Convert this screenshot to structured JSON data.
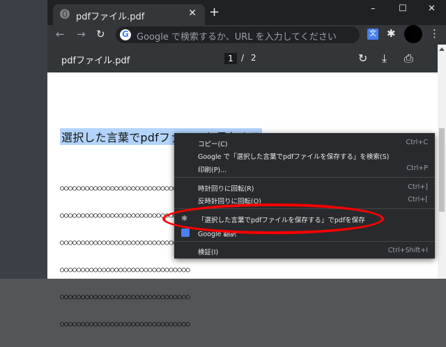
{
  "tab": {
    "title": "pdfファイル.pdf",
    "close": "✕",
    "new": "+"
  },
  "window": {
    "minimize": "–",
    "maximize": "☐",
    "close": "✕"
  },
  "toolbar": {
    "back": "←",
    "forward": "→",
    "reload": "↻",
    "omnibox_placeholder": "Google で検索するか、URL を入力してください"
  },
  "pdf": {
    "title": "pdfファイル.pdf",
    "page_current": "1",
    "page_sep": "/",
    "page_total": "2"
  },
  "document": {
    "heading": "選択した言葉でpdfファイルを保存する",
    "circles": [
      "○○○○○○○○○○○○○○○○○○○○○○○○○○○○○○○",
      "○○○○○○○○○○○○○○○○○○○○○○○○○○○○○○○",
      "○○○○○○○○○○○○○○○○○○○○○○○○○○○○○○○",
      "○○○○○○○○○○○○○○○○○○○○○○○○○○○○○○○",
      "○○○○○○○○○○○○○○○○○○○○○○○○○○○○○○○",
      "○○○○○○○○○○○○○○○○○○○○○○○○○○○○○○○"
    ]
  },
  "context_menu": {
    "copy": "コピー(C)",
    "copy_sc": "Ctrl+C",
    "search": "Google で「選択した言葉でpdfファイルを保存する」を検索(S)",
    "print": "印刷(P)...",
    "print_sc": "Ctrl+P",
    "rotate_cw": "時計回りに回転(R)",
    "rotate_cw_sc": "Ctrl+]",
    "rotate_ccw": "反時計回りに回転(O)",
    "rotate_ccw_sc": "Ctrl+[",
    "save_ext": "「選択した言葉でpdfファイルを保存する」でpdfを保存",
    "translate": "Google 翻訳",
    "inspect": "検証(I)",
    "inspect_sc": "Ctrl+Shift+I"
  },
  "colors": {
    "annotation": "#ff0000",
    "selection": "#b3d4fc",
    "menu_bg": "#292a2d"
  }
}
